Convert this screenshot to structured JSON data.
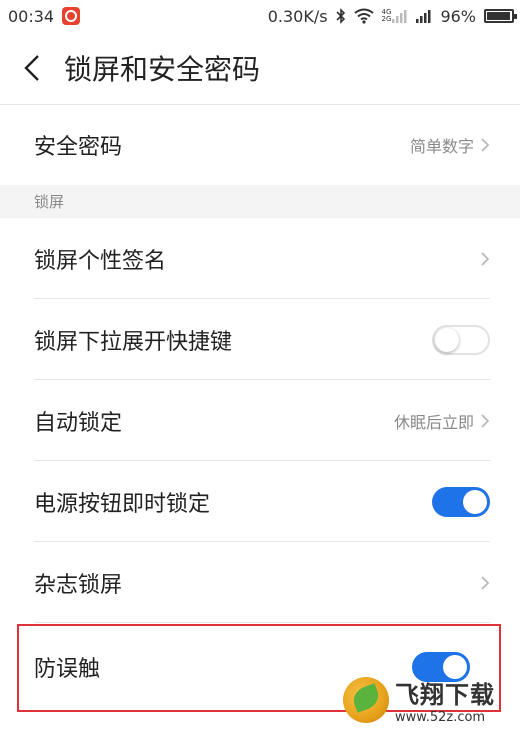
{
  "status_bar": {
    "time": "00:34",
    "speed": "0.30K/s",
    "net_tag_top": "4G",
    "net_tag_bottom": "2G",
    "battery": "96%"
  },
  "header": {
    "title": "锁屏和安全密码"
  },
  "rows": [
    {
      "label": "安全密码",
      "value": "简单数字"
    },
    {
      "label": "锁屏个性签名"
    },
    {
      "label": "锁屏下拉展开快捷键",
      "toggle": false
    },
    {
      "label": "自动锁定",
      "value": "休眠后立即"
    },
    {
      "label": "电源按钮即时锁定",
      "toggle": true
    },
    {
      "label": "杂志锁屏"
    },
    {
      "label": "防误触",
      "toggle": true
    }
  ],
  "section": {
    "label": "锁屏"
  },
  "watermark": {
    "brand": "飞翔下载",
    "url": "www.52z.com"
  },
  "colors": {
    "accent": "#1e73e8",
    "highlight_border": "#e0313b"
  },
  "icons": {
    "back": "back-arrow-icon",
    "chevron": "chevron-right-icon"
  }
}
